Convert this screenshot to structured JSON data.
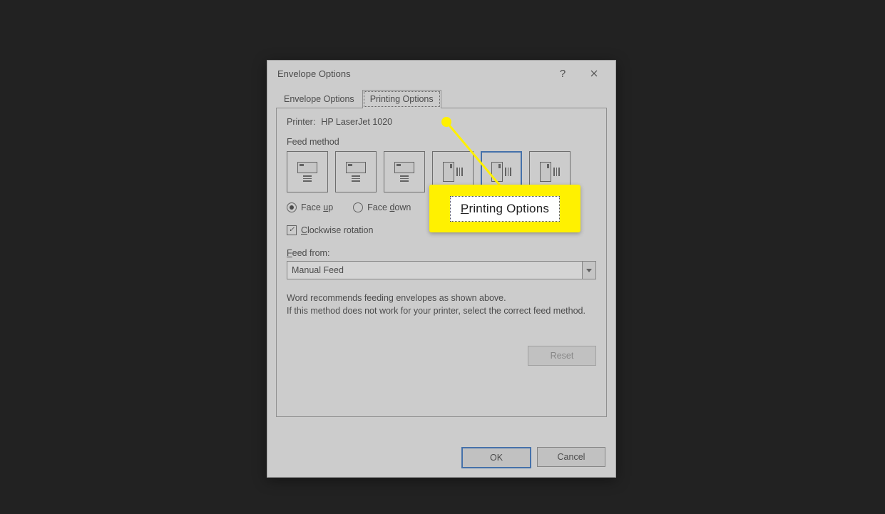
{
  "dialog": {
    "title": "Envelope Options",
    "help_tooltip": "?",
    "tabs": [
      {
        "label": "Envelope Options"
      },
      {
        "label": "Printing Options"
      }
    ],
    "active_tab": 1,
    "printer_label": "Printer:",
    "printer_name": "HP LaserJet 1020",
    "feed_method_label": "Feed method",
    "feed_selected_index": 4,
    "face_up_label": "Face up",
    "face_down_label": "Face down",
    "face_orientation": "up",
    "clockwise_label": "Clockwise rotation",
    "clockwise_checked": true,
    "feed_from_label": "Feed from:",
    "feed_from_value": "Manual Feed",
    "recommend_text": "Word recommends feeding envelopes as shown above.\nIf this method does not work for your printer, select the correct feed method.",
    "reset_label": "Reset",
    "ok_label": "OK",
    "cancel_label": "Cancel"
  },
  "callout": {
    "label": "Printing Options"
  }
}
